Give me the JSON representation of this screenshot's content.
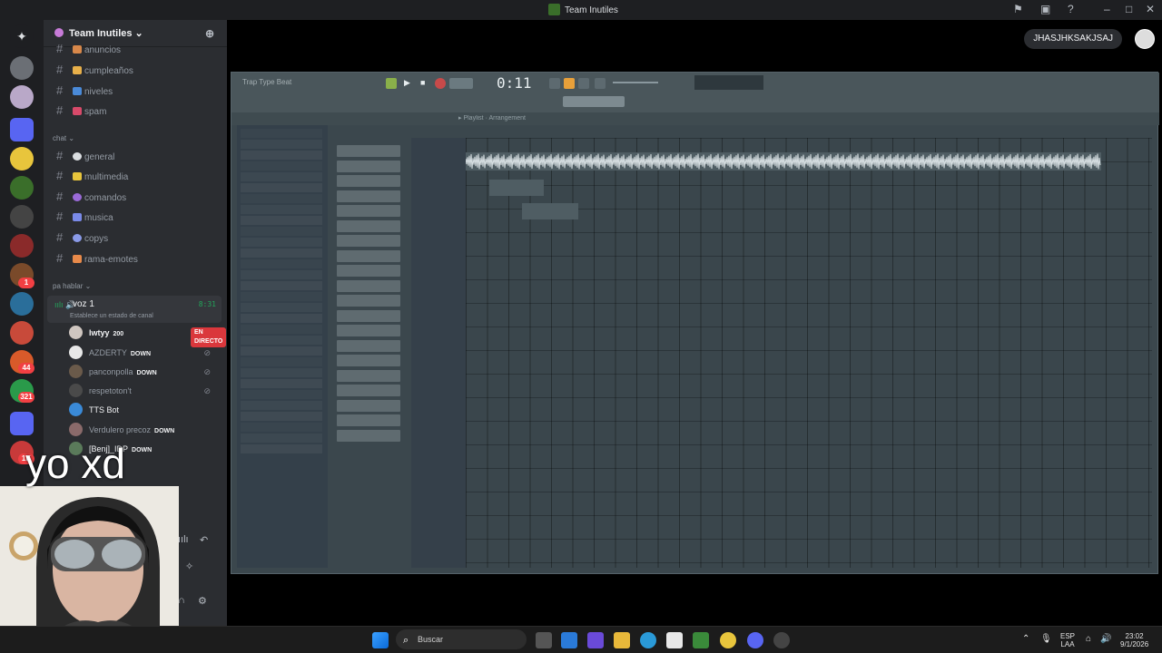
{
  "window": {
    "title": "Team Inutiles"
  },
  "server": {
    "name": "Team Inutiles"
  },
  "rail": {
    "badges": [
      "1",
      "44",
      "321",
      "1K"
    ]
  },
  "channels_top": [
    {
      "name": "anuncios"
    },
    {
      "name": "cumpleaños"
    },
    {
      "name": "niveles"
    },
    {
      "name": "spam"
    }
  ],
  "categories": {
    "chat": "chat",
    "voice": "pa hablar"
  },
  "channels_chat": [
    {
      "name": "general"
    },
    {
      "name": "multimedia"
    },
    {
      "name": "comandos"
    },
    {
      "name": "musica"
    },
    {
      "name": "copys"
    },
    {
      "name": "rama-emotes"
    }
  ],
  "voice": {
    "name": "voz 1",
    "time": "8:31",
    "status": "Establece un estado de canal"
  },
  "members": [
    {
      "name": "lwtyy",
      "tag": "200",
      "live": "EN DIRECTO"
    },
    {
      "name": "AZDERTY",
      "tag": "DOWN"
    },
    {
      "name": "panconpolla",
      "tag": "DOWN"
    },
    {
      "name": "respetoton't",
      "tag": ""
    },
    {
      "name": "TTS Bot",
      "tag": ""
    },
    {
      "name": "Verdulero precoz",
      "tag": "DOWN"
    },
    {
      "name": "[Benj]_IDP",
      "tag": "DOWN"
    }
  ],
  "overlay": {
    "caption": "yo xd"
  },
  "stream": {
    "user": "JHASJHKSAKJSAJ",
    "fl_time": "0:11",
    "fl_song": "Trap Type Beat"
  },
  "taskbar": {
    "search_placeholder": "Buscar",
    "lang_top": "ESP",
    "lang_bottom": "LAA",
    "time": "23:02",
    "date": "9/1/2026"
  },
  "colors": {
    "discord_bg": "#2b2d31",
    "rail_bg": "#1e1f22",
    "live_red": "#da373c",
    "voice_green": "#23a55a"
  }
}
